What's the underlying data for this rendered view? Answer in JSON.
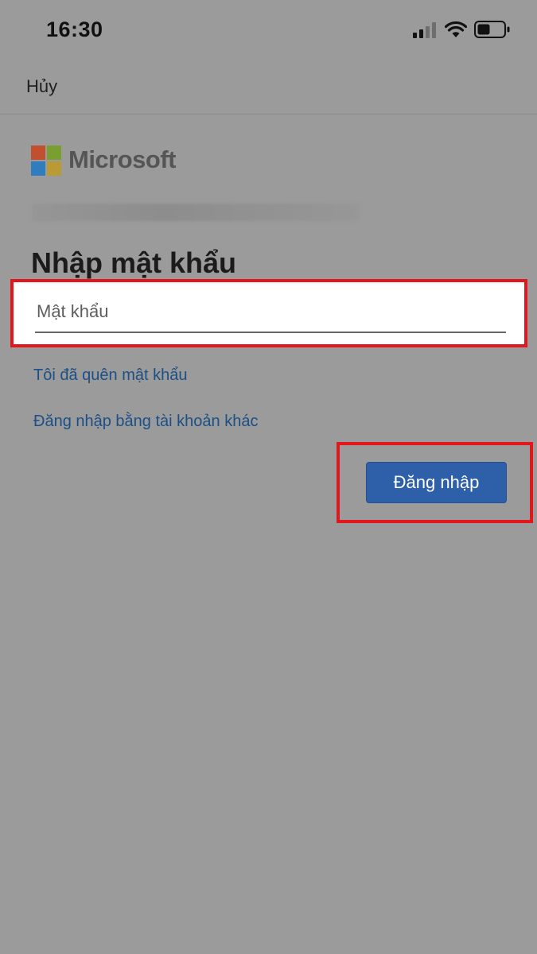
{
  "status_bar": {
    "time": "16:30",
    "icons": [
      "signal-icon",
      "wifi-icon",
      "battery-icon"
    ]
  },
  "nav": {
    "cancel_label": "Hủy"
  },
  "brand": {
    "name": "Microsoft",
    "logo_colors": [
      "#c2502f",
      "#79a02e",
      "#2f7cbf",
      "#b99a34"
    ]
  },
  "page": {
    "title": "Nhập mật khẩu"
  },
  "password_field": {
    "placeholder": "Mật khẩu",
    "value": ""
  },
  "links": {
    "forgot_password": "Tôi đã quên mật khẩu",
    "other_account": "Đăng nhập bằng tài khoản khác"
  },
  "actions": {
    "sign_in_label": "Đăng nhập"
  },
  "colors": {
    "overlay": "#9b9b9b",
    "link": "#1c4f86",
    "button": "#2d60a8",
    "highlight": "#e3161c"
  }
}
